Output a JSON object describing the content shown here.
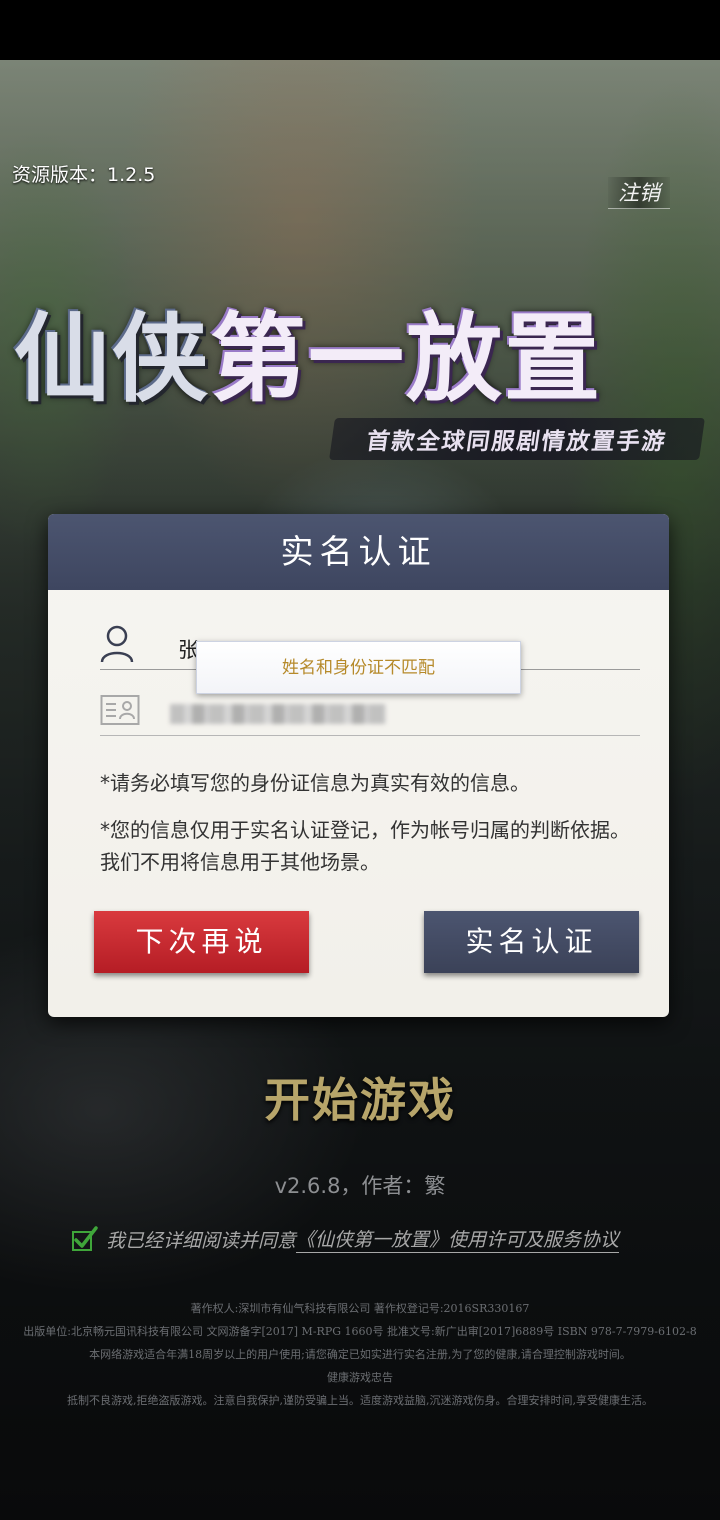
{
  "top_bar": {
    "resource_version": "资源版本：1.2.5",
    "logout_label": "注销"
  },
  "logo": {
    "title_part_a": "仙侠",
    "title_part_b": "第一放置",
    "slogan": "首款全球同服剧情放置手游"
  },
  "dialog": {
    "title": "实名认证",
    "name_value": "张",
    "toast_message": "姓名和身份证不匹配",
    "note_1": "*请务必填写您的身份证信息为真实有效的信息。",
    "note_2": "*您的信息仅用于实名认证登记，作为帐号归属的判断依据。我们不用将信息用于其他场景。",
    "later_button": "下次再说",
    "verify_button": "实名认证"
  },
  "main": {
    "start_game": "开始游戏",
    "app_version": "v2.6.8，作者：繁",
    "agreement_prefix": "我已经详细阅读并同意",
    "agreement_link": "《仙侠第一放置》使用许可及服务协议",
    "agreement_checked": true
  },
  "footer": [
    "著作权人:深圳市有仙气科技有限公司    著作权登记号:2016SR330167",
    "出版单位:北京畅元国讯科技有限公司 文网游备字[2017] M-RPG 1660号 批准文号:新广出审[2017]6889号 ISBN 978-7-7979-6102-8",
    "本网络游戏适合年满18周岁以上的用户使用;请您确定已如实进行实名注册,为了您的健康,请合理控制游戏时间。",
    "健康游戏忠告",
    "抵制不良游戏,拒绝盗版游戏。注意自我保护,谨防受骗上当。适度游戏益脑,沉迷游戏伤身。合理安排时间,享受健康生活。"
  ],
  "colors": {
    "dialog_header": "#444c67",
    "later_button": "#c82a30",
    "verify_button": "#444c67",
    "start_game": "#b7a56a",
    "check_green": "#3fa63a"
  },
  "icons": [
    "user-icon",
    "id-card-icon",
    "checkbox-check-icon"
  ]
}
